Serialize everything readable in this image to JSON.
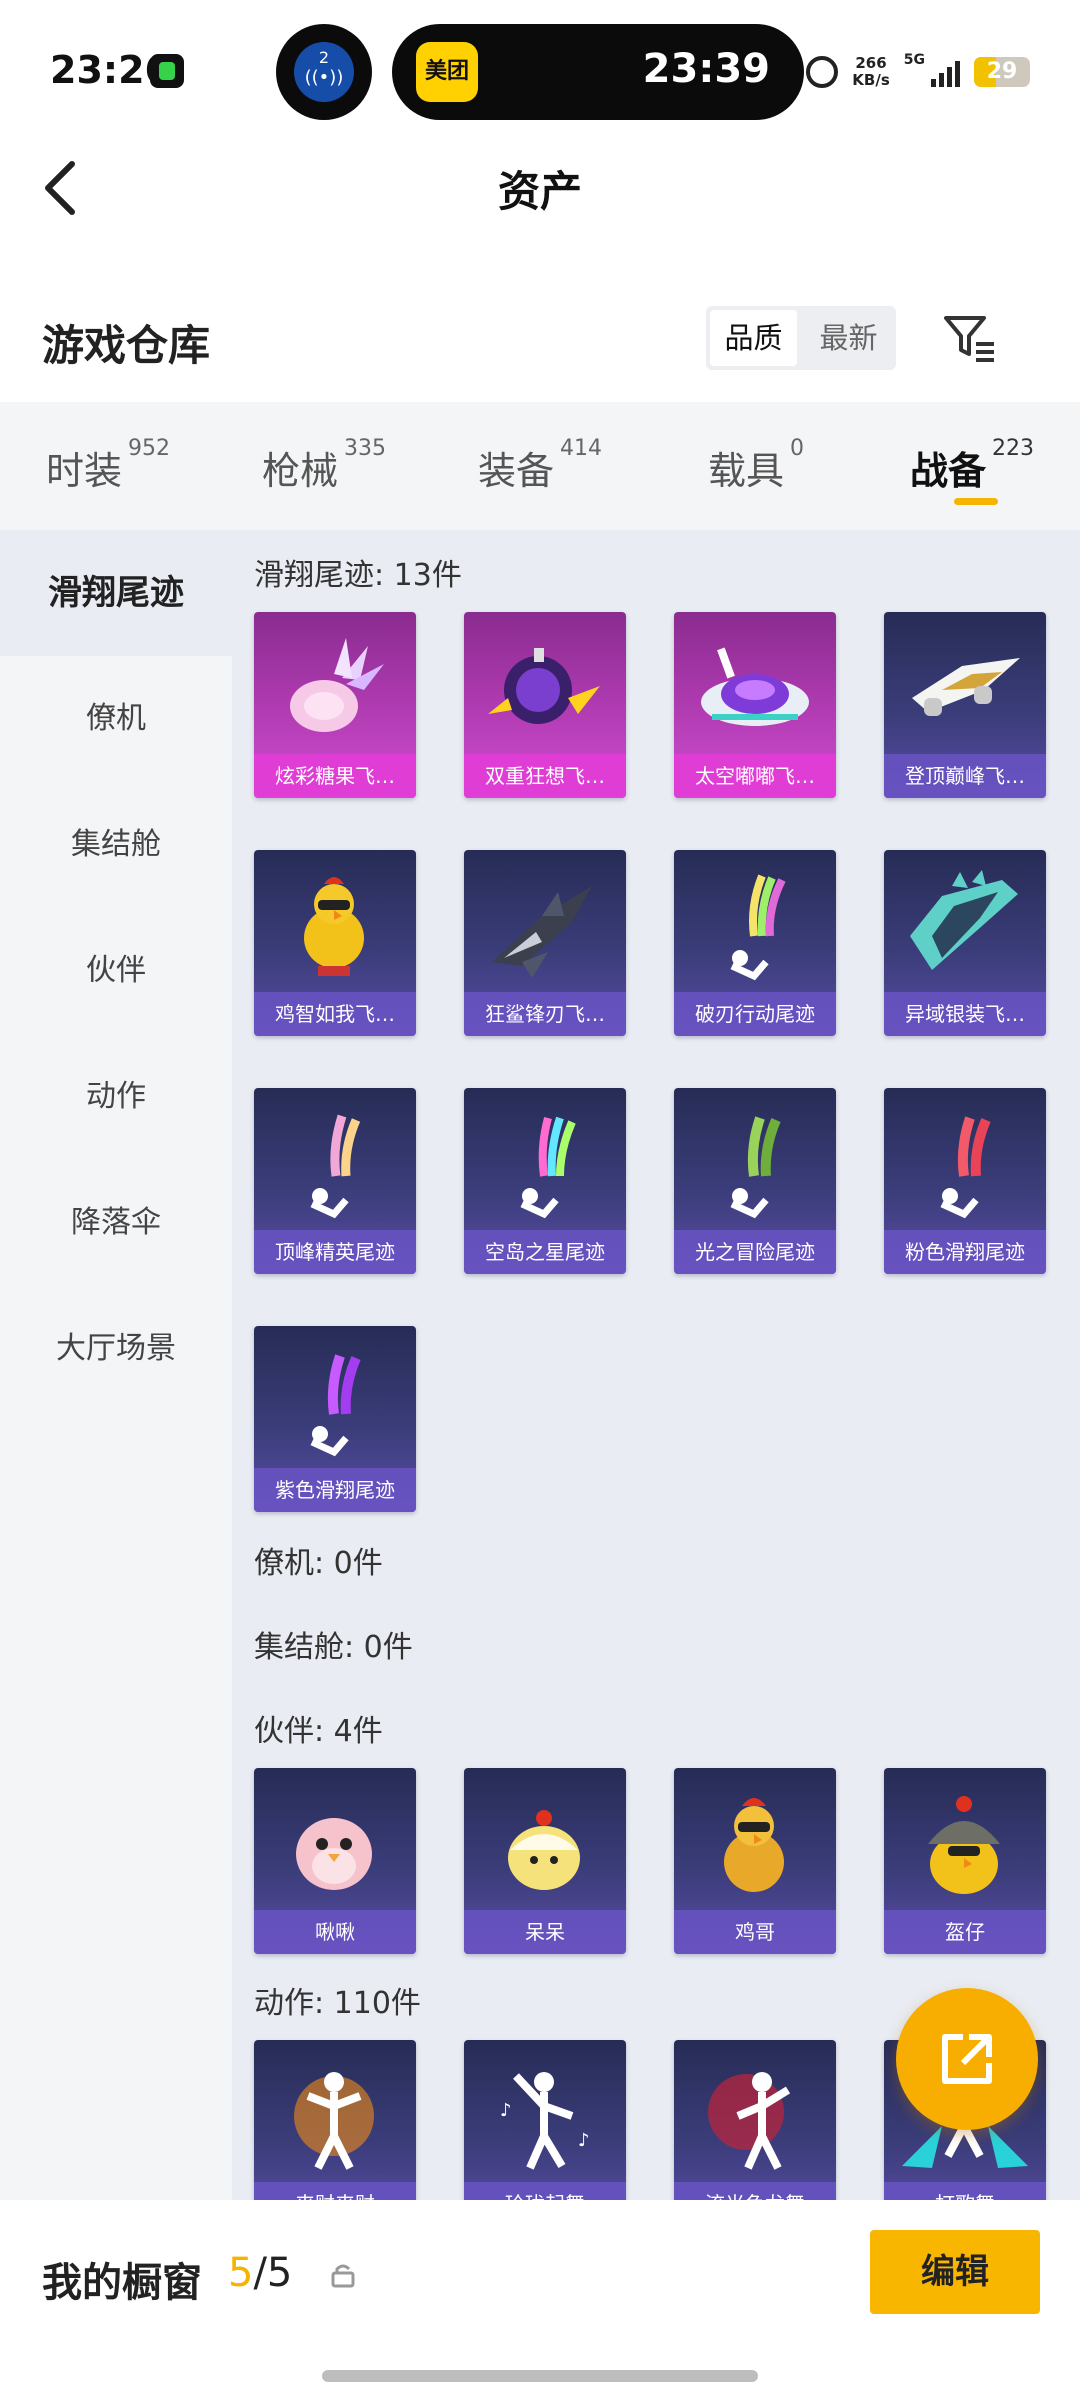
{
  "status_bar": {
    "time": "23:26",
    "cast_badge": "2",
    "island_app": "美团",
    "island_time": "23:39",
    "net_speed_value": "266",
    "net_speed_unit": "KB/s",
    "network": "5G",
    "battery": "29"
  },
  "header": {
    "title": "资产"
  },
  "section": {
    "title": "游戏仓库",
    "sort_options": [
      "品质",
      "最新"
    ],
    "sort_selected": "品质"
  },
  "tabs": [
    {
      "label": "时装",
      "count": "952"
    },
    {
      "label": "枪械",
      "count": "335"
    },
    {
      "label": "装备",
      "count": "414"
    },
    {
      "label": "载具",
      "count": "0"
    },
    {
      "label": "战备",
      "count": "223"
    }
  ],
  "active_tab": "战备",
  "side_nav": [
    {
      "label": "滑翔尾迹"
    },
    {
      "label": "僚机"
    },
    {
      "label": "集结舱"
    },
    {
      "label": "伙伴"
    },
    {
      "label": "动作"
    },
    {
      "label": "降落伞"
    },
    {
      "label": "大厅场景"
    }
  ],
  "active_side": "滑翔尾迹",
  "categories": {
    "glide": {
      "header": "滑翔尾迹: 13件",
      "items": [
        "炫彩糖果飞…",
        "双重狂想飞…",
        "太空嘟嘟飞…",
        "登顶巅峰飞…",
        "鸡智如我飞…",
        "狂鲨锋刃飞…",
        "破刃行动尾迹",
        "异域银装飞…",
        "顶峰精英尾迹",
        "空岛之星尾迹",
        "光之冒险尾迹",
        "粉色滑翔尾迹",
        "紫色滑翔尾迹"
      ]
    },
    "wingman": {
      "header": "僚机: 0件"
    },
    "pod": {
      "header": "集结舱: 0件"
    },
    "partner": {
      "header": "伙伴: 4件",
      "items": [
        "啾啾",
        "呆呆",
        "鸡哥",
        "盔仔"
      ]
    },
    "emote": {
      "header": "动作: 110件",
      "items": [
        "来财来财",
        "玲珑起舞",
        "流光鱼龙舞",
        "打歌舞"
      ]
    }
  },
  "bottom": {
    "label": "我的橱窗",
    "current": "5",
    "total": "/5",
    "edit_label": "编辑"
  }
}
